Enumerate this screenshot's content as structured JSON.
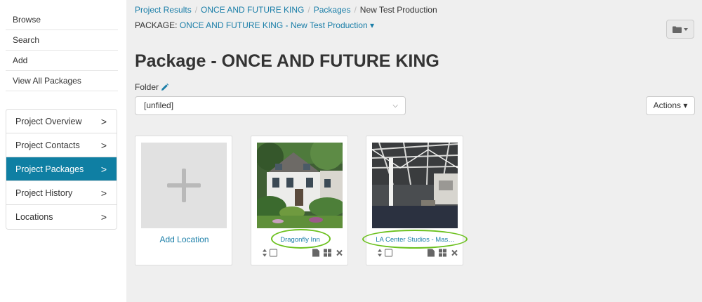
{
  "sidebar": {
    "top_links": [
      "Browse",
      "Search",
      "Add",
      "View All Packages"
    ],
    "project_nav": [
      {
        "label": "Project Overview",
        "active": false
      },
      {
        "label": "Project Contacts",
        "active": false
      },
      {
        "label": "Project Packages",
        "active": true
      },
      {
        "label": "Project History",
        "active": false
      },
      {
        "label": "Locations",
        "active": false
      }
    ],
    "chevron": ">"
  },
  "breadcrumb": {
    "items": [
      "Project Results",
      "ONCE AND FUTURE KING",
      "Packages"
    ],
    "current": "New Test Production",
    "separator": "/"
  },
  "package_line": {
    "label": "PACKAGE:",
    "value": "ONCE AND FUTURE KING - New Test Production ▾"
  },
  "page_title": "Package - ONCE AND FUTURE KING",
  "folder": {
    "label": "Folder",
    "selected": "[unfiled]",
    "caret": "⌵"
  },
  "actions_button": "Actions ▾",
  "add_location_label": "Add Location",
  "locations": [
    {
      "name": "Dragonfly Inn"
    },
    {
      "name": "LA Center Studios - Mas…"
    }
  ],
  "colors": {
    "link": "#1a7ea8",
    "active_nav": "#0f7fa3",
    "highlight_oval": "#6cc11e",
    "main_bg": "#efefef"
  },
  "icons": [
    "pencil-icon",
    "folder-icon",
    "sort-icon",
    "checkbox-icon",
    "file-icon",
    "grid-icon",
    "remove-icon",
    "plus-icon",
    "chevron-right-icon"
  ]
}
